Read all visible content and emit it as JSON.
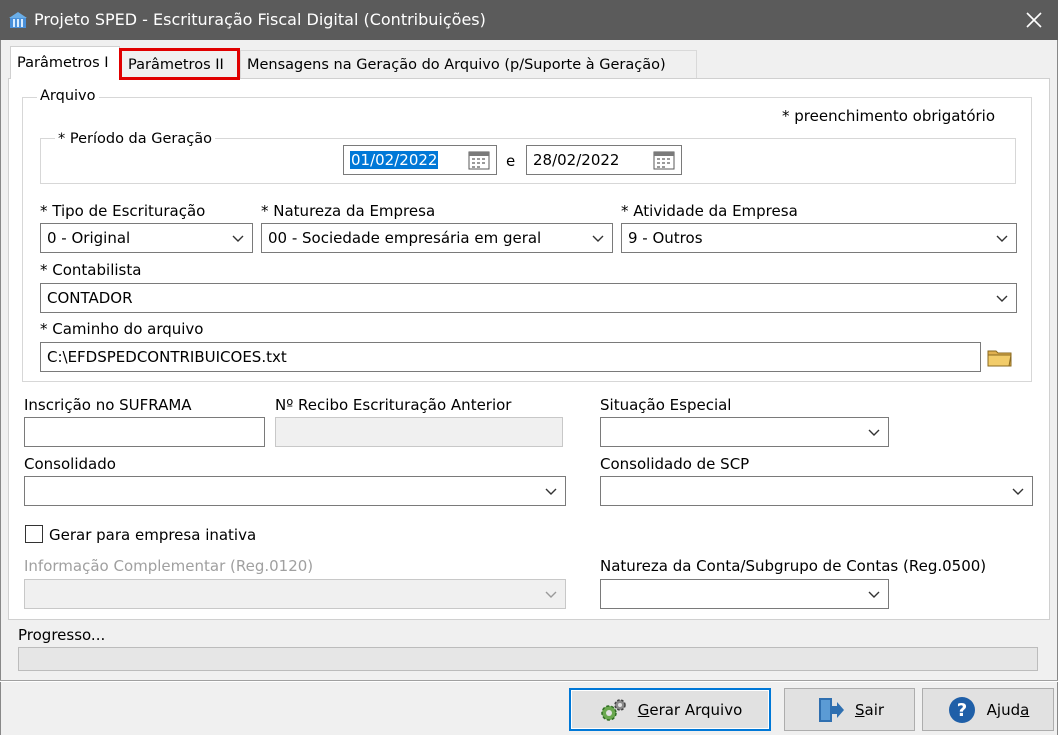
{
  "window": {
    "title": "Projeto SPED - Escrituração Fiscal Digital (Contribuições)"
  },
  "tabs": [
    {
      "label": "Parâmetros I"
    },
    {
      "label": "Parâmetros II"
    },
    {
      "label": "Mensagens na Geração do Arquivo (p/Suporte à Geração)"
    }
  ],
  "arquivo": {
    "legend": "Arquivo",
    "required_note": "* preenchimento obrigatório",
    "periodo": {
      "legend": "* Período da Geração",
      "start": "01/02/2022",
      "sep": "e",
      "end": "28/02/2022"
    },
    "tipo": {
      "label": "* Tipo de Escrituração",
      "value": "0 - Original"
    },
    "natureza": {
      "label": "* Natureza da Empresa",
      "value": "00 - Sociedade empresária em geral"
    },
    "atividade": {
      "label": "* Atividade da Empresa",
      "value": "9 - Outros"
    },
    "contabilista": {
      "label": "* Contabilista",
      "value": "CONTADOR"
    },
    "caminho": {
      "label": "* Caminho do arquivo",
      "value": "C:\\EFDSPEDCONTRIBUICOES.txt"
    }
  },
  "fields": {
    "suframa": {
      "label": "Inscrição no SUFRAMA",
      "value": ""
    },
    "recibo": {
      "label": "Nº Recibo Escrituração Anterior",
      "value": ""
    },
    "situacao": {
      "label": "Situação Especial",
      "value": ""
    },
    "consolidado": {
      "label": "Consolidado",
      "value": ""
    },
    "consolidado_scp": {
      "label": "Consolidado de SCP",
      "value": ""
    },
    "inativa": {
      "label": "Gerar para empresa inativa",
      "checked": false
    },
    "info_compl": {
      "label": "Informação Complementar (Reg.0120)",
      "value": ""
    },
    "natureza_conta": {
      "label": "Natureza da Conta/Subgrupo de Contas (Reg.0500)",
      "value": ""
    }
  },
  "progress": {
    "label": "Progresso...",
    "value": 0
  },
  "buttons": {
    "gerar": {
      "pre": "",
      "key": "G",
      "post": "erar Arquivo"
    },
    "sair": {
      "pre": "",
      "key": "S",
      "post": "air"
    },
    "ajuda": {
      "pre": "Ajud",
      "key": "a",
      "post": ""
    }
  },
  "colors": {
    "titlebar": "#5b5b5b",
    "highlight": "#e00000",
    "selection": "#0078d7"
  }
}
